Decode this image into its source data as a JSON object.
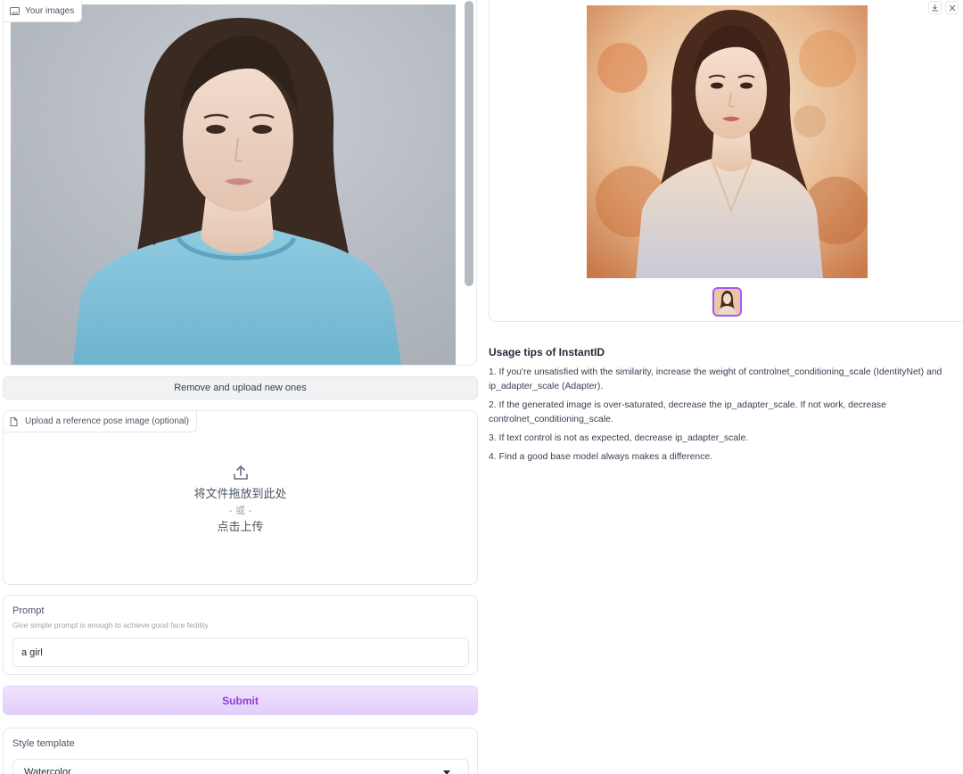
{
  "gallery": {
    "label": "Your images",
    "remove_button": "Remove and upload new ones"
  },
  "pose_upload": {
    "label": "Upload a reference pose image (optional)",
    "drop_text": "将文件拖放到此处",
    "or_text": "- 或 -",
    "click_text": "点击上传"
  },
  "prompt": {
    "label": "Prompt",
    "info": "Give simple prompt is enough to achieve good face fedility",
    "value": "a girl"
  },
  "submit": {
    "label": "Submit"
  },
  "style_template": {
    "label": "Style template",
    "selected": "Watercolor"
  },
  "result": {
    "actions": [
      "download-icon",
      "close-icon"
    ]
  },
  "tips": {
    "title": "Usage tips of InstantID",
    "items": [
      "1. If you're unsatisfied with the similarity, increase the weight of controlnet_conditioning_scale (IdentityNet) and ip_adapter_scale (Adapter).",
      "2. If the generated image is over-saturated, decrease the ip_adapter_scale. If not work, decrease controlnet_conditioning_scale.",
      "3. If text control is not as expected, decrease ip_adapter_scale.",
      "4. Find a good base model always makes a difference."
    ]
  },
  "colors": {
    "accent": "#a855f7",
    "submit_text": "#8b3fd6",
    "submit_bg": "#e2cdfb",
    "border": "#e5e7eb"
  }
}
